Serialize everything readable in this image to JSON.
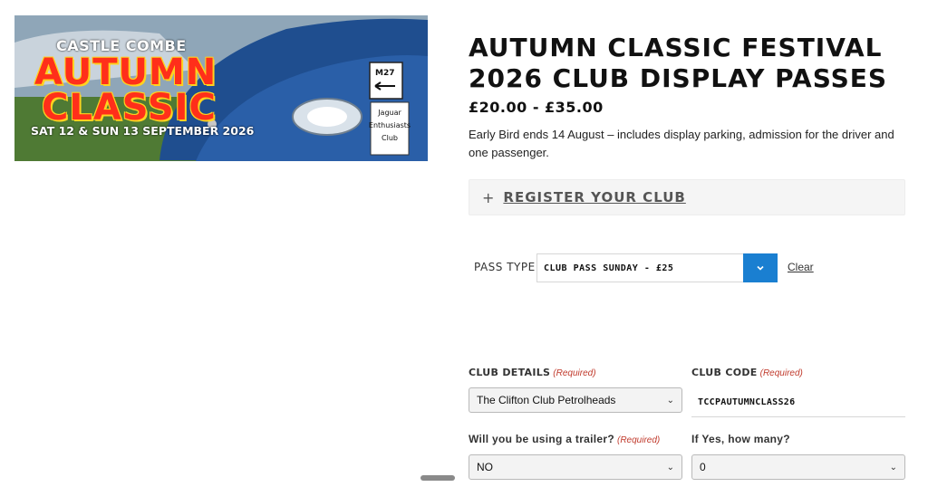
{
  "hero": {
    "brand_top": "CASTLE COMBE",
    "brand_line1": "AUTUMN",
    "brand_line2": "CLASSIC",
    "brand_date": "SAT 12 & SUN 13 SEPTEMBER 2026",
    "sign_text": "M27",
    "club_sign": "Jaguar Enthusiasts Club"
  },
  "product": {
    "title": "AUTUMN CLASSIC FESTIVAL 2026 CLUB DISPLAY PASSES",
    "price": "£20.00 - £35.00",
    "description": "Early Bird ends 14 August – includes display parking, admission for the driver and one passenger."
  },
  "register": {
    "icon": "plus-icon",
    "label": "REGISTER YOUR CLUB"
  },
  "pass": {
    "label": "PASS TYPE",
    "selected": "CLUB PASS SUNDAY - £25",
    "clear_label": "Clear",
    "accent": "#1a7fd1"
  },
  "form": {
    "required_text": "(Required)",
    "club_details": {
      "label": "CLUB DETAILS",
      "value": "The Clifton Club Petrolheads"
    },
    "club_code": {
      "label": "CLUB CODE",
      "value": "TCCPAUTUMNCLASS26"
    },
    "trailer": {
      "label": "Will you be using a trailer?",
      "value": "NO"
    },
    "how_many": {
      "label": "If Yes, how many?",
      "value": "0"
    }
  }
}
